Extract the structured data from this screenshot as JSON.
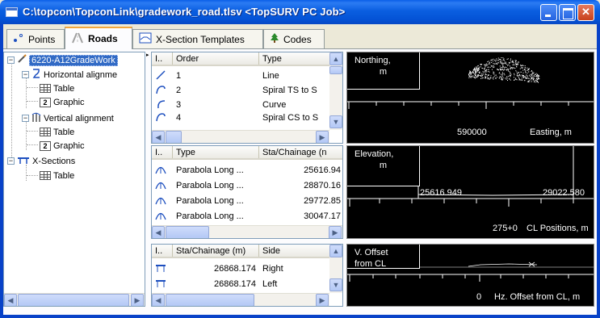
{
  "window": {
    "title": "C:\\topcon\\TopconLink\\gradework_road.tlsv  <TopSURV PC Job>"
  },
  "tabs": [
    {
      "label": "Points",
      "icon": "points-icon"
    },
    {
      "label": "Roads",
      "icon": "roads-icon"
    },
    {
      "label": "X-Section Templates",
      "icon": "xsection-template-icon"
    },
    {
      "label": "Codes",
      "icon": "codes-tree-icon"
    }
  ],
  "tree": {
    "road": "6220-A12GradeWork",
    "horizontal": "Horizontal alignme",
    "h_table": "Table",
    "h_graphic": "Graphic",
    "vertical": "Vertical alignment",
    "v_table": "Table",
    "v_graphic": "Graphic",
    "xsections": "X-Sections",
    "x_table": "Table"
  },
  "horizontal_grid": {
    "headers": [
      "I..",
      "Order",
      "Type"
    ],
    "rows": [
      {
        "icon": "line-icon",
        "order": "1",
        "type": "Line"
      },
      {
        "icon": "spiral-icon",
        "order": "2",
        "type": "Spiral TS to S"
      },
      {
        "icon": "curve-icon",
        "order": "3",
        "type": "Curve"
      },
      {
        "icon": "spiral-icon",
        "order": "4",
        "type": "Spiral CS to S"
      }
    ]
  },
  "vertical_grid": {
    "headers": [
      "I..",
      "Type",
      "Sta/Chainage (n"
    ],
    "rows": [
      {
        "icon": "parabola-icon",
        "type": "Parabola Long ...",
        "station": "25616.94"
      },
      {
        "icon": "parabola-icon",
        "type": "Parabola Long ...",
        "station": "28870.16"
      },
      {
        "icon": "parabola-icon",
        "type": "Parabola Long ...",
        "station": "29772.85"
      },
      {
        "icon": "parabola-icon",
        "type": "Parabola Long ...",
        "station": "30047.17"
      }
    ]
  },
  "xsection_grid": {
    "headers": [
      "I..",
      "Sta/Chainage (m)",
      "Side"
    ],
    "rows": [
      {
        "icon": "xsection-icon",
        "station": "26868.174",
        "side": "Right"
      },
      {
        "icon": "xsection-icon",
        "station": "26868.174",
        "side": "Left"
      }
    ]
  },
  "plan_view": {
    "y_label_1": "Northing,",
    "y_label_2": "m",
    "x_tick": "590000",
    "x_label": "Easting, m"
  },
  "profile_view": {
    "y_label_1": "Elevation,",
    "y_label_2": "m",
    "start_station": "25616.949",
    "end_station": "29022.580",
    "x_tick": "275+0",
    "x_label": "CL Positions, m"
  },
  "section_view": {
    "y_label_1": "V. Offset",
    "y_label_2": "from CL",
    "x_tick": "0",
    "x_label": "Hz. Offset from CL, m"
  },
  "colors": {
    "chart_bg": "#000000",
    "chart_fg": "#ffffff",
    "selection": "#316ac5",
    "titlebar": "#0a5ee0"
  }
}
